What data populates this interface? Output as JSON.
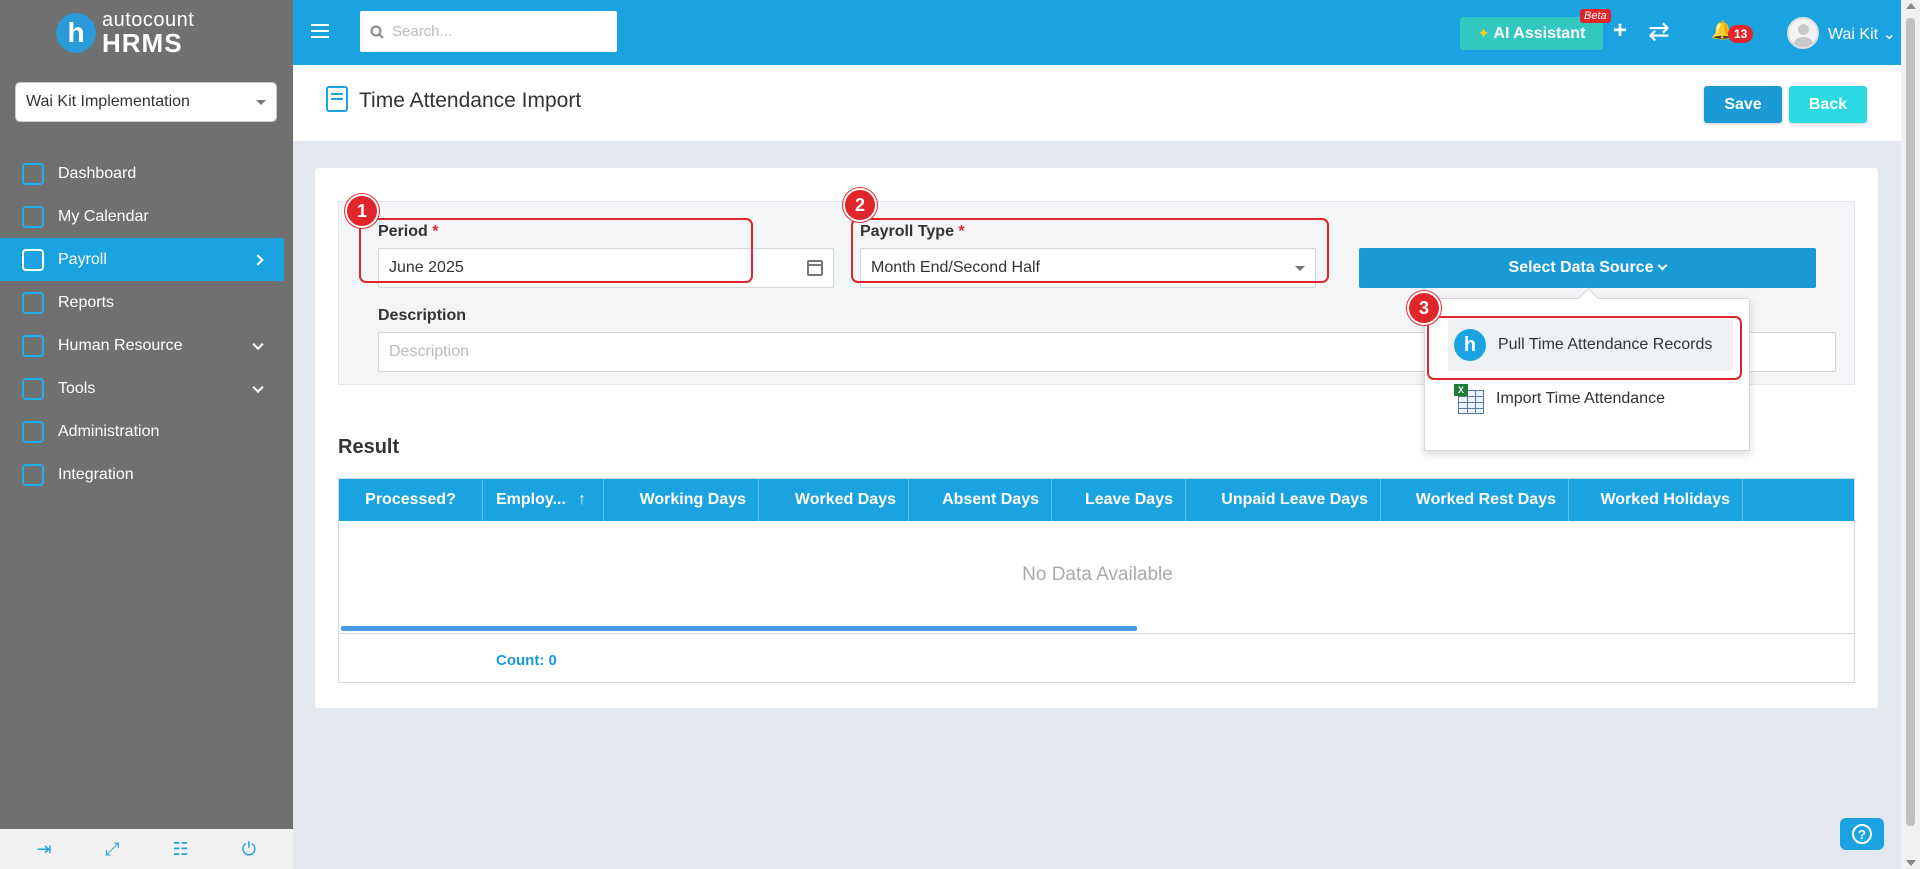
{
  "app": {
    "logo_top": "autocount",
    "logo_bottom": "HRMS",
    "logo_letter": "h"
  },
  "sidebar": {
    "company": "Wai Kit Implementation",
    "items": [
      {
        "label": "Dashboard",
        "icon": "gauge-icon",
        "arrow": "",
        "active": false
      },
      {
        "label": "My Calendar",
        "icon": "calendar-icon",
        "arrow": "",
        "active": false
      },
      {
        "label": "Payroll",
        "icon": "money-icon",
        "arrow": "right",
        "active": true
      },
      {
        "label": "Reports",
        "icon": "report-icon",
        "arrow": "",
        "active": false
      },
      {
        "label": "Human Resource",
        "icon": "people-icon",
        "arrow": "down",
        "active": false
      },
      {
        "label": "Tools",
        "icon": "tools-icon",
        "arrow": "down",
        "active": false
      },
      {
        "label": "Administration",
        "icon": "admin-icon",
        "arrow": "",
        "active": false
      },
      {
        "label": "Integration",
        "icon": "integration-icon",
        "arrow": "",
        "active": false
      }
    ],
    "bottom_icons": [
      "logout-icon",
      "fullscreen-icon",
      "translate-icon",
      "power-icon"
    ]
  },
  "topbar": {
    "search_placeholder": "Search...",
    "ai_label": "AI Assistant",
    "beta_label": "Beta",
    "notification_count": "13",
    "user_name": "Wai Kit"
  },
  "page": {
    "title": "Time Attendance Import",
    "save_label": "Save",
    "back_label": "Back"
  },
  "form": {
    "period_label": "Period",
    "period_value": "June 2025",
    "payroll_type_label": "Payroll Type",
    "payroll_type_value": "Month End/Second Half",
    "description_label": "Description",
    "description_placeholder": "Description",
    "required_mark": "*",
    "data_source_label": "Select Data Source"
  },
  "dropdown": {
    "items": [
      {
        "label": "Pull Time Attendance Records",
        "icon": "hrms-h-icon"
      },
      {
        "label": "Import Time Attendance",
        "icon": "excel-grid-icon"
      }
    ]
  },
  "steps": [
    "1",
    "2",
    "3"
  ],
  "result": {
    "title": "Result",
    "columns": [
      "Processed?",
      "Employ...",
      "Working Days",
      "Worked Days",
      "Absent Days",
      "Leave Days",
      "Unpaid Leave Days",
      "Worked Rest Days",
      "Worked Holidays"
    ],
    "empty_text": "No Data Available",
    "count_text": "Count: 0"
  },
  "colors": {
    "primary": "#1aa3e0",
    "sidebar": "#707070",
    "highlight": "#e0262a",
    "back_button": "#2bd9e3"
  }
}
